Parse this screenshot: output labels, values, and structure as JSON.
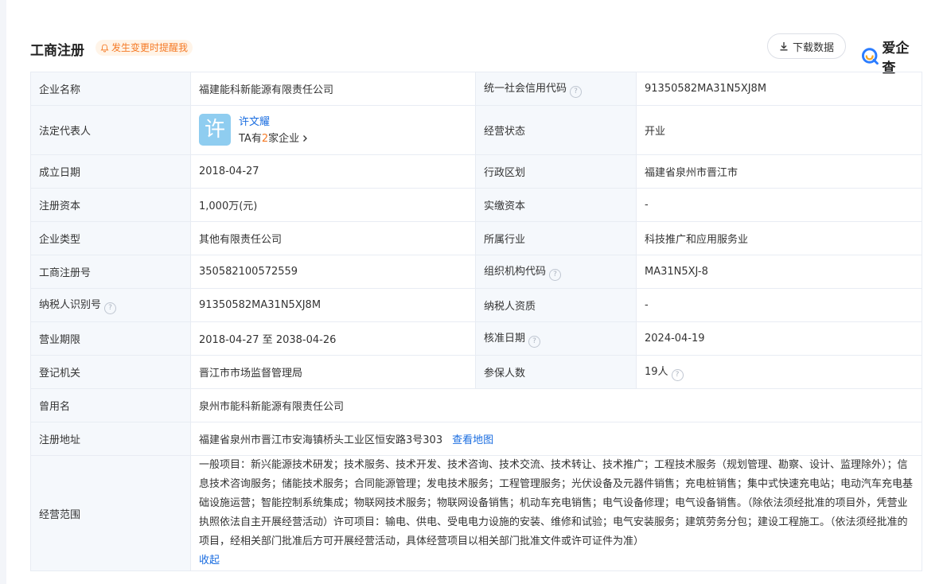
{
  "header": {
    "title": "工商注册",
    "remind_label": "发生变更时提醒我",
    "download_label": "下载数据",
    "brand": "爱企查"
  },
  "rows": {
    "company_name_label": "企业名称",
    "company_name": "福建能科新能源有限责任公司",
    "credit_code_label": "统一社会信用代码",
    "credit_code": "91350582MA31N5XJ8M",
    "legal_rep_label": "法定代表人",
    "legal_rep_avatar": "许",
    "legal_rep_name": "许文耀",
    "legal_rep_prefix": "TA有",
    "legal_rep_count": "2",
    "legal_rep_suffix": "家企业",
    "status_label": "经营状态",
    "status": "开业",
    "founded_label": "成立日期",
    "founded": "2018-04-27",
    "region_label": "行政区划",
    "region": "福建省泉州市晋江市",
    "reg_capital_label": "注册资本",
    "reg_capital": "1,000万(元)",
    "paid_capital_label": "实缴资本",
    "paid_capital": "-",
    "type_label": "企业类型",
    "type": "其他有限责任公司",
    "industry_label": "所属行业",
    "industry": "科技推广和应用服务业",
    "reg_no_label": "工商注册号",
    "reg_no": "350582100572559",
    "org_code_label": "组织机构代码",
    "org_code": "MA31N5XJ-8",
    "taxpayer_id_label": "纳税人识别号",
    "taxpayer_id": "91350582MA31N5XJ8M",
    "taxpayer_qual_label": "纳税人资质",
    "taxpayer_qual": "-",
    "term_label": "营业期限",
    "term": "2018-04-27 至 2038-04-26",
    "approval_label": "核准日期",
    "approval": "2024-04-19",
    "authority_label": "登记机关",
    "authority": "晋江市市场监督管理局",
    "insured_label": "参保人数",
    "insured": "19人",
    "former_name_label": "曾用名",
    "former_name": "泉州市能科新能源有限责任公司",
    "address_label": "注册地址",
    "address": "福建省泉州市晋江市安海镇桥头工业区恒安路3号303",
    "map_link": "查看地图",
    "scope_label": "经营范围",
    "scope": "一般项目：新兴能源技术研发；技术服务、技术开发、技术咨询、技术交流、技术转让、技术推广；工程技术服务（规划管理、勘察、设计、监理除外）；信息技术咨询服务；储能技术服务；合同能源管理；发电技术服务；工程管理服务；光伏设备及元器件销售；充电桩销售；集中式快速充电站；电动汽车充电基础设施运营；智能控制系统集成；物联网技术服务；物联网设备销售；机动车充电销售；电气设备修理；电气设备销售。（除依法须经批准的项目外，凭营业执照依法自主开展经营活动）许可项目：输电、供电、受电电力设施的安装、维修和试验；电气安装服务；建筑劳务分包；建设工程施工。（依法须经批准的项目，经相关部门批准后方可开展经营活动，具体经营项目以相关部门批准文件或许可证件为准）",
    "collapse": "收起"
  },
  "colors": {
    "accent": "#1a6de0",
    "orange": "#f57a26",
    "label_bg": "#f5f8fc"
  }
}
